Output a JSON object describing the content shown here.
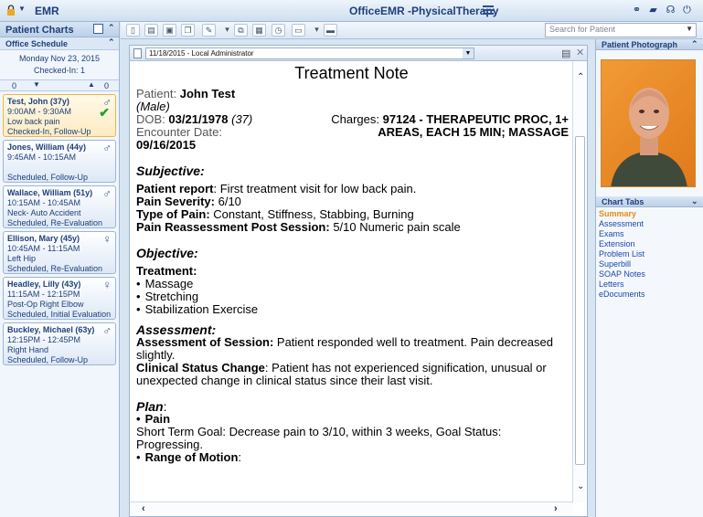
{
  "app": {
    "menu_label": "EMR",
    "title": "OfficeEMR -PhysicalTherapy"
  },
  "search": {
    "placeholder": "Search for Patient"
  },
  "left": {
    "title": "Patient Charts",
    "schedule_title": "Office Schedule",
    "date": "Monday Nov 23, 2015",
    "checked_in": "Checked-In: 1",
    "counter_left": "0",
    "counter_right": "0",
    "appointments": [
      {
        "name": "Test, John (37y)",
        "time": "9:00AM - 9:30AM",
        "reason": "Low back pain",
        "status": "Checked-In, Follow-Up",
        "gender": "male",
        "checked": true
      },
      {
        "name": "Jones, William (44y)",
        "time": "9:45AM - 10:15AM",
        "reason": "",
        "status": "Scheduled, Follow-Up",
        "gender": "male",
        "checked": false
      },
      {
        "name": "Wallace, William (51y)",
        "time": "10:15AM - 10:45AM",
        "reason": "Neck- Auto Accident",
        "status": "Scheduled, Re-Evaluation",
        "gender": "male",
        "checked": false
      },
      {
        "name": "Ellison, Mary (45y)",
        "time": "10:45AM - 11:15AM",
        "reason": "Left Hip",
        "status": "Scheduled, Re-Evaluation",
        "gender": "female",
        "checked": false
      },
      {
        "name": "Headley, Lilly (43y)",
        "time": "11:15AM - 12:15PM",
        "reason": "Post-Op Right Elbow",
        "status": "Scheduled, Initial Evaluation",
        "gender": "female",
        "checked": false
      },
      {
        "name": "Buckley, Michael (63y)",
        "time": "12:15PM - 12:45PM",
        "reason": "Right Hand",
        "status": "Scheduled, Follow-Up",
        "gender": "male",
        "checked": false
      }
    ]
  },
  "document": {
    "selector": "11/18/2015 - Local Administrator",
    "title": "Treatment Note",
    "patient_label": "Patient:",
    "patient_name": "John Test",
    "patient_gender": "(Male)",
    "dob_label": "DOB:",
    "dob": "03/21/1978",
    "age": "(37)",
    "charges_label": "Charges:",
    "charges": "97124 - THERAPEUTIC PROC, 1+ AREAS, EACH 15 MIN; MASSAGE",
    "encounter_label": "Encounter Date:",
    "encounter_date": "09/16/2015",
    "subjective_title": "Subjective:",
    "report_label": "Patient report",
    "report_text": ": First treatment visit for low back pain.",
    "severity_label": "Pain Severity:",
    "severity_text": " 6/10",
    "type_label": "Type of Pain:",
    "type_text": " Constant, Stiffness, Stabbing, Burning",
    "reassess_label": "Pain Reassessment Post Session:",
    "reassess_text": " 5/10 Numeric pain scale",
    "objective_title": "Objective:",
    "treatment_label": "Treatment:",
    "treatments": [
      "Massage",
      "Stretching",
      "Stabilization Exercise"
    ],
    "assessment_title": "Assessment:",
    "assess_session_label": "Assessment of Session:",
    "assess_session_text": " Patient responded well to treatment. Pain decreased slightly.",
    "clinical_label": "Clinical Status Change",
    "clinical_text": ": Patient has not experienced signification, unusual or unexpected change in clinical status since their last visit.",
    "plan_title": "Plan",
    "plan_colon": ":",
    "pain_label": "Pain",
    "pain_goal": "Short Term Goal: Decrease pain to 3/10, within 3 weeks, Goal Status: Progressing.",
    "rom_label": "Range of Motion",
    "rom_colon": ":"
  },
  "right": {
    "photo_title": "Patient Photograph",
    "tabs_title": "Chart Tabs",
    "tabs": [
      "Summary",
      "Assessment",
      "Exams",
      "Extension",
      "Problem List",
      "Superbill",
      "SOAP Notes",
      "Letters",
      "eDocuments"
    ]
  },
  "colors": {
    "accent": "#1f3f7a",
    "active_tab": "#e78b14",
    "link": "#1b46a8",
    "selected_appt": "#fdebc2"
  }
}
